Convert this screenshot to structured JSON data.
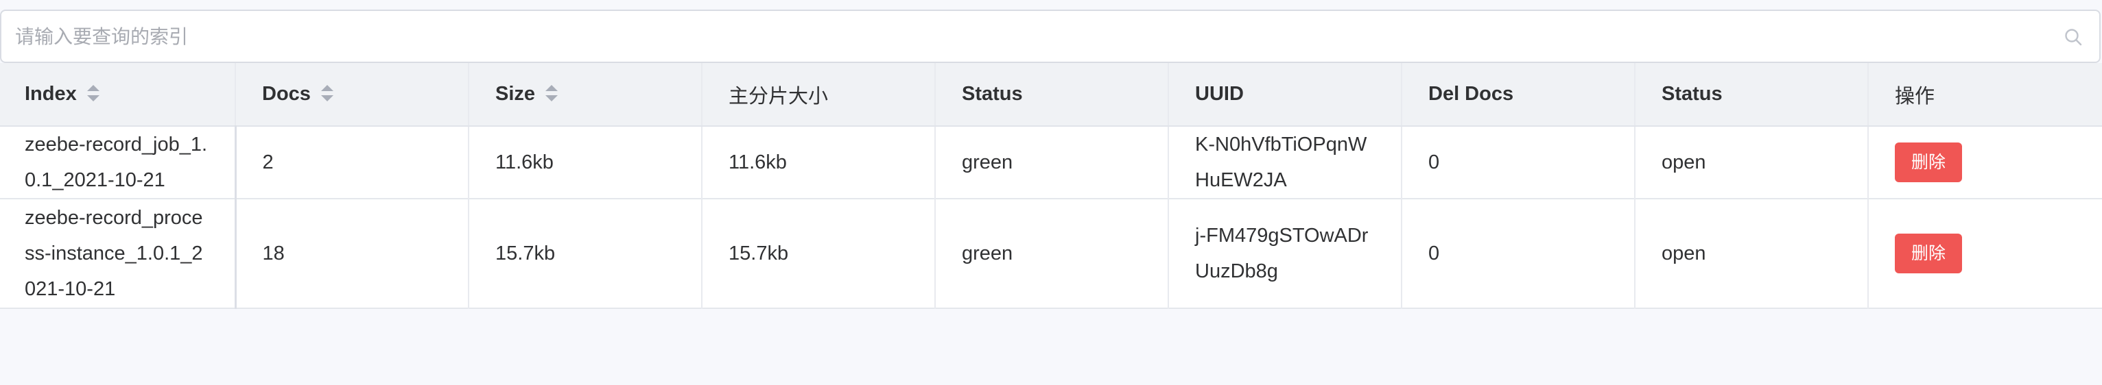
{
  "search": {
    "placeholder": "请输入要查询的索引",
    "value": ""
  },
  "icons": {
    "search": "search-icon",
    "sort": "sort-caret-icon"
  },
  "colors": {
    "delete_button": "#f05654",
    "header_bg": "#f0f2f5"
  },
  "table": {
    "columns": [
      {
        "label": "Index",
        "sortable": true
      },
      {
        "label": "Docs",
        "sortable": true
      },
      {
        "label": "Size",
        "sortable": true
      },
      {
        "label": "主分片大小",
        "sortable": false
      },
      {
        "label": "Status",
        "sortable": false
      },
      {
        "label": "UUID",
        "sortable": false
      },
      {
        "label": "Del Docs",
        "sortable": false
      },
      {
        "label": "Status",
        "sortable": false
      },
      {
        "label": "操作",
        "sortable": false
      }
    ],
    "rows": [
      {
        "index": "zeebe-record_job_1.0.1_2021-10-21",
        "docs": "2",
        "size": "11.6kb",
        "primary_size": "11.6kb",
        "health": "green",
        "uuid": "K-N0hVfbTiOPqnWHuEW2JA",
        "del_docs": "0",
        "status": "open",
        "action_label": "删除"
      },
      {
        "index": "zeebe-record_process-instance_1.0.1_2021-10-21",
        "docs": "18",
        "size": "15.7kb",
        "primary_size": "15.7kb",
        "health": "green",
        "uuid": "j-FM479gSTOwADrUuzDb8g",
        "del_docs": "0",
        "status": "open",
        "action_label": "删除"
      }
    ]
  }
}
